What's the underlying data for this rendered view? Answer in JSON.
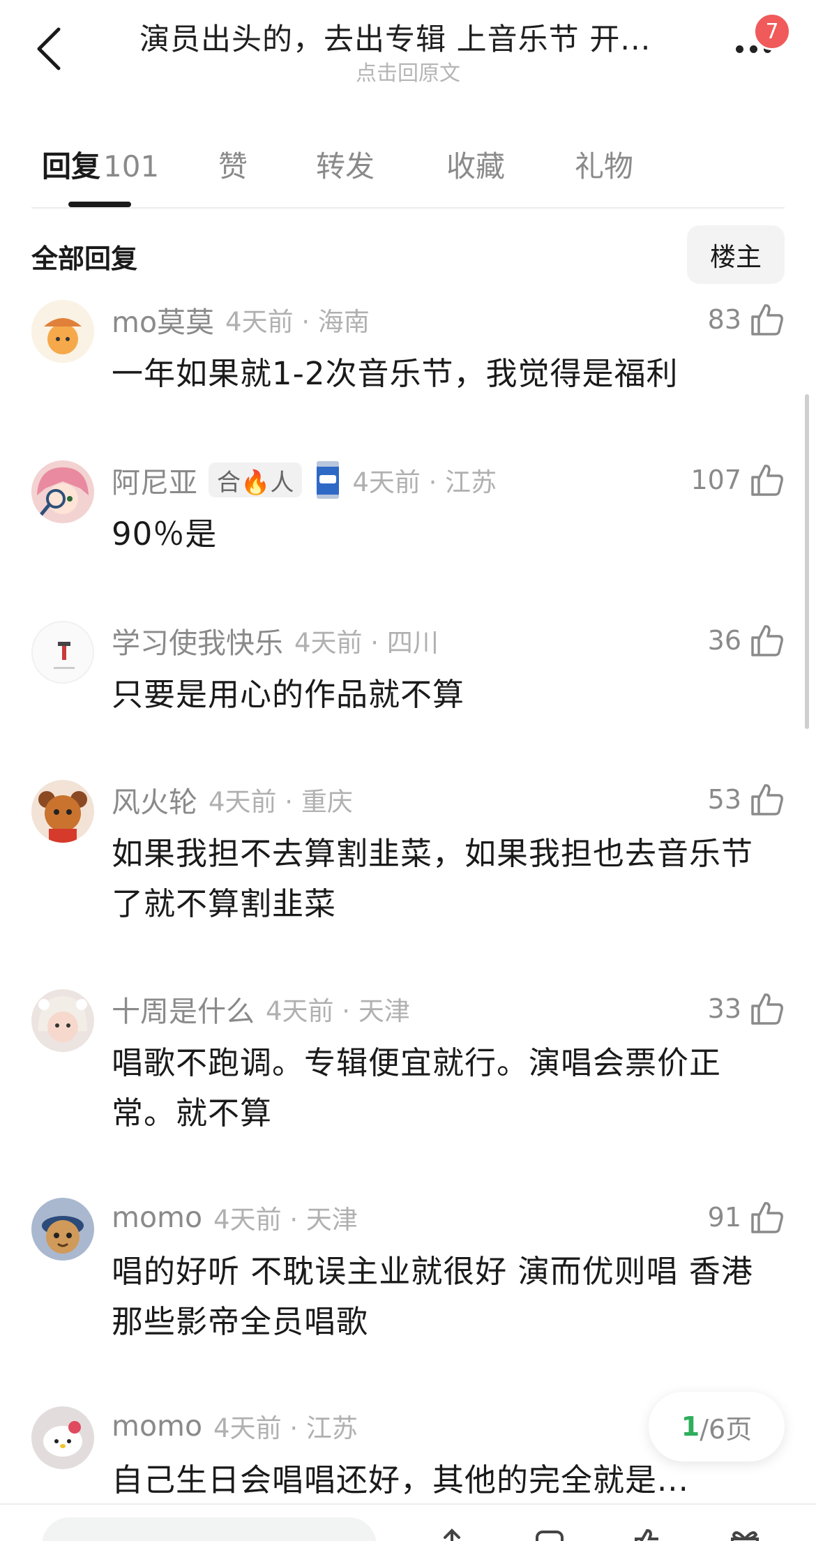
{
  "header": {
    "title": "演员出头的，去出专辑 上音乐节 开...",
    "subtitle": "点击回原文",
    "notification_count": "7"
  },
  "tabs": [
    {
      "label": "回复",
      "count": "101"
    },
    {
      "label": "赞"
    },
    {
      "label": "转发"
    },
    {
      "label": "收藏"
    },
    {
      "label": "礼物"
    }
  ],
  "filter": {
    "label": "全部回复",
    "op_button": "楼主"
  },
  "comments": [
    {
      "name": "mo莫莫",
      "time": "4天前 · 海南",
      "likes": "83",
      "text": "一年如果就1-2次音乐节，我觉得是福利",
      "avatar_color": "#f5a94b"
    },
    {
      "name": "阿尼亚",
      "tag": "合🔥人",
      "time": "4天前 · 江苏",
      "likes": "107",
      "text": "90％是",
      "avatar_color": "#e79aa6"
    },
    {
      "name": "学习使我快乐",
      "time": "4天前 · 四川",
      "likes": "36",
      "text": "只要是用心的作品就不算",
      "avatar_color": "#f4f4f4"
    },
    {
      "name": "风火轮",
      "time": "4天前 · 重庆",
      "likes": "53",
      "text": "如果我担不去算割韭菜，如果我担也去音乐节了就不算割韭菜",
      "avatar_color": "#c9732f"
    },
    {
      "name": "十周是什么",
      "time": "4天前 · 天津",
      "likes": "33",
      "text": "唱歌不跑调。专辑便宜就行。演唱会票价正常。就不算",
      "avatar_color": "#e8d4cc"
    },
    {
      "name": "momo",
      "time": "4天前 · 天津",
      "likes": "91",
      "text": "唱的好听 不耽误主业就很好 演而优则唱 香港那些影帝全员唱歌",
      "avatar_color": "#d09a5a"
    },
    {
      "name": "momo",
      "time": "4天前 · 江苏",
      "likes": "",
      "text": "自己生日会唱唱还好，其他的完全就是...",
      "avatar_color": "#cfc6c6"
    }
  ],
  "pagination": {
    "current": "1",
    "total": "/6页"
  },
  "colors": {
    "accent": "#2fae5c",
    "badge": "#f05a5a"
  }
}
